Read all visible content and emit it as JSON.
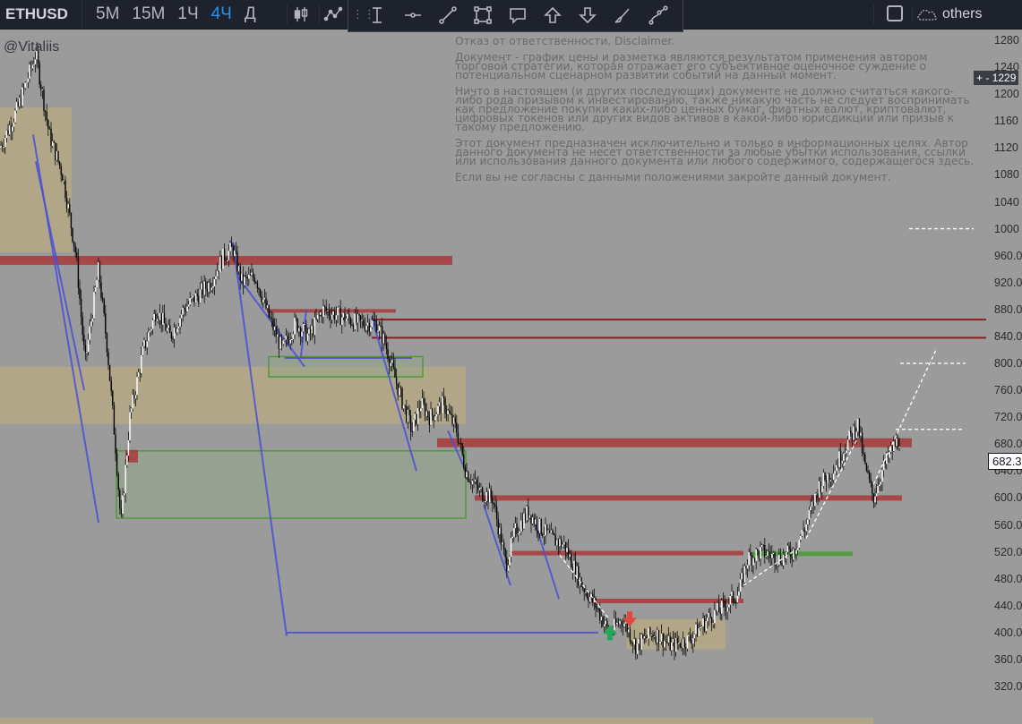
{
  "toolbar": {
    "symbol": "ETHUSD",
    "intervals": [
      {
        "label": "5М",
        "active": false
      },
      {
        "label": "15М",
        "active": false
      },
      {
        "label": "1Ч",
        "active": false
      },
      {
        "label": "4Ч",
        "active": true
      },
      {
        "label": "Д",
        "active": false
      }
    ],
    "others_label": "others",
    "icons": [
      "candles-icon",
      "indicators-icon",
      "cursor-icon",
      "horizontal-line-icon",
      "trend-line-icon",
      "rectangle-icon",
      "callout-icon",
      "arrow-up-icon",
      "arrow-down-icon",
      "brush-icon",
      "path-icon"
    ]
  },
  "watermark": "@Vitaliis",
  "disclaimer": [
    "Отказ от ответственности. Disclaimer.",
    "Документ - график цены и разметка являются результатом применения автором торговой стратегии, которая отражает его субъективное оценочное суждение о потенциальном сценарном развитии событий на данный момент.",
    "Ничто в настоящем (и других последующих) документе не должно считаться какого-либо рода призывом к инвестированию, также никакую часть не следует воспринимать как предложение покупки каких-либо ценных бумаг, фиатных валют, криптовалют, цифровых токенов или других видов активов в какой-либо юрисдикции или призыв к такому предложению.",
    "Этот документ предназначен исключительно и только в информационных целях. Автор данного документа не несет ответственности за любые убытки использования, ссылки или использования данного документа или любого содержимого, содержащегося здесь.",
    "Если вы не согласны с данными положениями закройте данный документ."
  ],
  "price_scale": {
    "labels": [
      "1280",
      "1240",
      "1200",
      "1160",
      "1120",
      "1080",
      "1040",
      "1000",
      "960.0",
      "920.0",
      "880.0",
      "840.0",
      "800.0",
      "760.0",
      "720.0",
      "680.0",
      "640.0",
      "600.0",
      "560.0",
      "520.0",
      "480.0",
      "440.0",
      "400.0",
      "360.0",
      "320.0"
    ],
    "current_price": "682.3",
    "plus_label": "+ - 1229"
  },
  "colors": {
    "background": "#9b9b9b",
    "resistance": "#a83a3a",
    "support_zone": "#4e9a3a",
    "trend_line": "#4a4fd6",
    "supply_zone": "#b8a981",
    "projection": "#ffffff"
  },
  "chart_data": {
    "type": "candlestick",
    "symbol": "ETHUSD",
    "interval": "4Ч",
    "ylim": [
      320,
      1280
    ],
    "close_path": [
      [
        0,
        1120
      ],
      [
        20,
        1180
      ],
      [
        40,
        1260
      ],
      [
        55,
        1140
      ],
      [
        70,
        1080
      ],
      [
        85,
        960
      ],
      [
        95,
        800
      ],
      [
        110,
        940
      ],
      [
        120,
        820
      ],
      [
        130,
        660
      ],
      [
        135,
        560
      ],
      [
        145,
        720
      ],
      [
        160,
        820
      ],
      [
        175,
        880
      ],
      [
        190,
        840
      ],
      [
        205,
        880
      ],
      [
        220,
        900
      ],
      [
        235,
        920
      ],
      [
        250,
        960
      ],
      [
        260,
        970
      ],
      [
        270,
        920
      ],
      [
        285,
        930
      ],
      [
        300,
        870
      ],
      [
        315,
        820
      ],
      [
        330,
        860
      ],
      [
        345,
        840
      ],
      [
        360,
        880
      ],
      [
        380,
        870
      ],
      [
        400,
        860
      ],
      [
        420,
        860
      ],
      [
        430,
        830
      ],
      [
        445,
        760
      ],
      [
        460,
        700
      ],
      [
        470,
        740
      ],
      [
        480,
        720
      ],
      [
        495,
        740
      ],
      [
        510,
        700
      ],
      [
        520,
        640
      ],
      [
        535,
        610
      ],
      [
        550,
        600
      ],
      [
        565,
        500
      ],
      [
        575,
        550
      ],
      [
        590,
        580
      ],
      [
        600,
        560
      ],
      [
        615,
        540
      ],
      [
        630,
        530
      ],
      [
        650,
        470
      ],
      [
        665,
        440
      ],
      [
        680,
        400
      ],
      [
        695,
        420
      ],
      [
        710,
        380
      ],
      [
        730,
        400
      ],
      [
        750,
        380
      ],
      [
        770,
        390
      ],
      [
        790,
        420
      ],
      [
        810,
        440
      ],
      [
        825,
        460
      ],
      [
        835,
        510
      ],
      [
        850,
        520
      ],
      [
        870,
        510
      ],
      [
        885,
        520
      ],
      [
        900,
        560
      ],
      [
        915,
        620
      ],
      [
        930,
        640
      ],
      [
        945,
        680
      ],
      [
        958,
        710
      ],
      [
        965,
        650
      ],
      [
        975,
        600
      ],
      [
        985,
        640
      ],
      [
        995,
        670
      ],
      [
        1005,
        690
      ]
    ],
    "annotations": {
      "resistance_lines": [
        953,
        876,
        840,
        682,
        605,
        518,
        456
      ],
      "support_line": 518,
      "zones": [
        {
          "kind": "supply",
          "from": 965,
          "to": 1180
        },
        {
          "kind": "supply",
          "from": 710,
          "to": 795
        },
        {
          "kind": "demand",
          "from": 570,
          "to": 670
        },
        {
          "kind": "demand",
          "from": 375,
          "to": 420
        }
      ],
      "projection_levels": [
        1000,
        800,
        700
      ]
    }
  }
}
